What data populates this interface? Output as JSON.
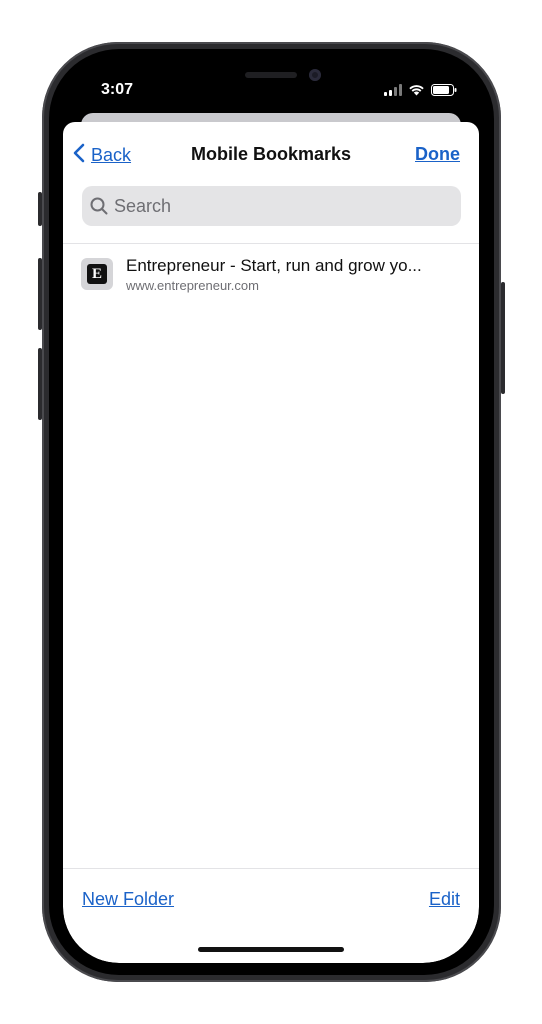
{
  "status_bar": {
    "time": "3:07"
  },
  "nav": {
    "back_label": "Back",
    "title": "Mobile Bookmarks",
    "done_label": "Done"
  },
  "search": {
    "placeholder": "Search"
  },
  "bookmarks": [
    {
      "title": "Entrepreneur - Start, run and grow yo...",
      "url": "www.entrepreneur.com",
      "favicon_letter": "E",
      "icon": "entrepreneur-favicon"
    }
  ],
  "toolbar": {
    "new_folder_label": "New Folder",
    "edit_label": "Edit"
  },
  "colors": {
    "accent": "#1a62c8",
    "search_bg": "#e4e4e6",
    "text_secondary": "#6e6e73"
  }
}
